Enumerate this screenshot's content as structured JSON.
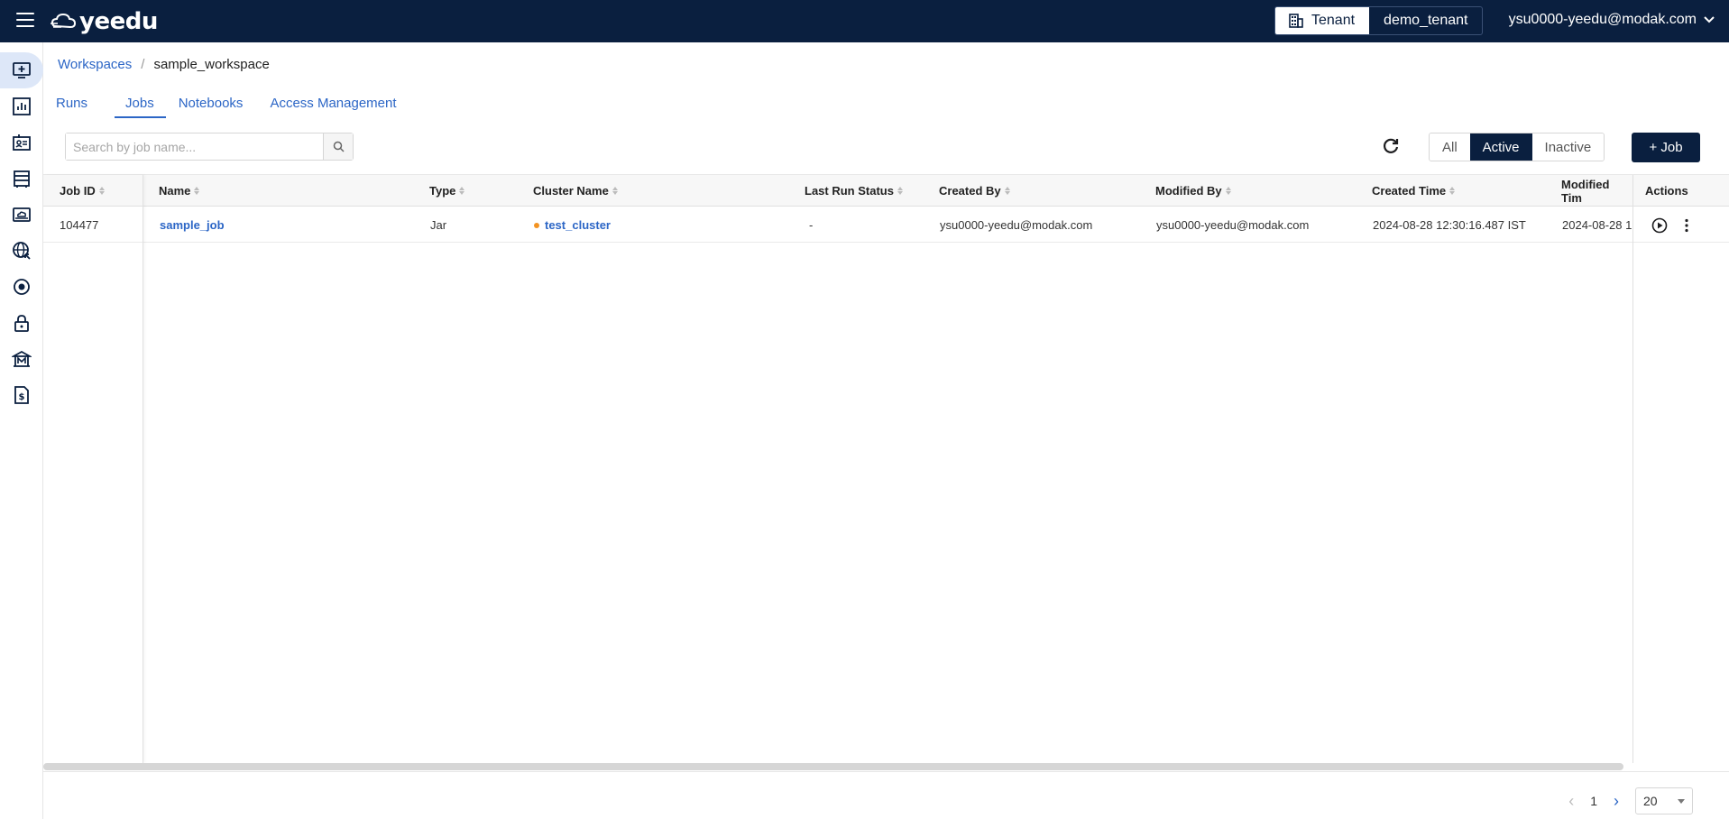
{
  "app": {
    "logo_text": "yeedu"
  },
  "header": {
    "tenant_label": "Tenant",
    "tenant_value": "demo_tenant",
    "user_email": "ysu0000-yeedu@modak.com"
  },
  "sidebar": {
    "items": [
      {
        "icon": "add-monitor-icon",
        "active": true
      },
      {
        "icon": "bar-chart-icon",
        "active": false
      },
      {
        "icon": "id-card-icon",
        "active": false
      },
      {
        "icon": "server-rack-icon",
        "active": false
      },
      {
        "icon": "cloud-drive-icon",
        "active": false
      },
      {
        "icon": "globe-network-icon",
        "active": false
      },
      {
        "icon": "target-icon",
        "active": false
      },
      {
        "icon": "lock-icon",
        "active": false
      },
      {
        "icon": "bank-m-icon",
        "active": false
      },
      {
        "icon": "billing-document-icon",
        "active": false
      }
    ]
  },
  "breadcrumb": {
    "parent": "Workspaces",
    "separator": "/",
    "current": "sample_workspace"
  },
  "tabs": [
    {
      "label": "Runs",
      "selected": false
    },
    {
      "label": "Jobs",
      "selected": true
    },
    {
      "label": "Notebooks",
      "selected": false
    },
    {
      "label": "Access Management",
      "selected": false
    }
  ],
  "search": {
    "placeholder": "Search by job name..."
  },
  "filters": {
    "all": "All",
    "active": "Active",
    "inactive": "Inactive",
    "selected": "Active"
  },
  "add_job_label": "+ Job",
  "table": {
    "columns": {
      "job_id": "Job ID",
      "name": "Name",
      "type": "Type",
      "cluster_name": "Cluster Name",
      "last_run_status": "Last Run Status",
      "created_by": "Created By",
      "modified_by": "Modified By",
      "created_time": "Created Time",
      "modified_time": "Modified Tim",
      "actions": "Actions"
    },
    "rows": [
      {
        "job_id": "104477",
        "name": "sample_job",
        "type": "Jar",
        "cluster_name": "test_cluster",
        "last_run_status": "-",
        "created_by": "ysu0000-yeedu@modak.com",
        "modified_by": "ysu0000-yeedu@modak.com",
        "created_time": "2024-08-28 12:30:16.487 IST",
        "modified_time": "2024-08-28 1"
      }
    ]
  },
  "pagination": {
    "current_page": "1",
    "page_size": "20"
  },
  "colors": {
    "brand_navy": "#0a1f3f",
    "link_blue": "#2c66c6",
    "cluster_status_orange": "#f39322"
  }
}
